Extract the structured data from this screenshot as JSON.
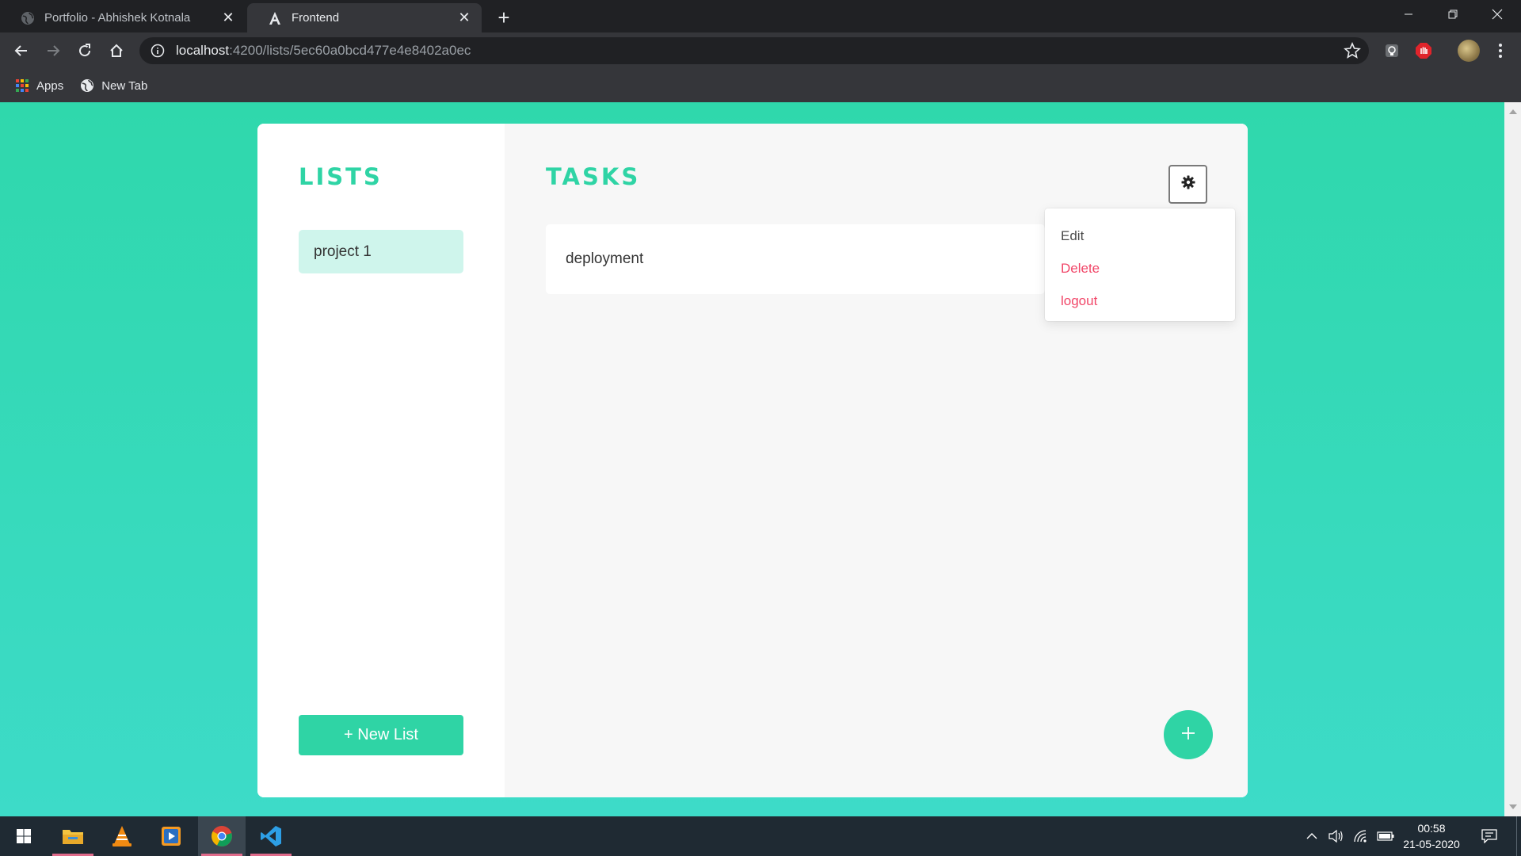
{
  "browser": {
    "tabs": [
      {
        "title": "Portfolio - Abhishek Kotnala",
        "active": false,
        "icon": "globe-icon"
      },
      {
        "title": "Frontend",
        "active": true,
        "icon": "angular-icon"
      }
    ],
    "url_host": "localhost",
    "url_rest": ":4200/lists/5ec60a0bcd477e4e8402a0ec",
    "bookmarks": [
      {
        "label": "Apps",
        "icon": "apps-grid-icon"
      },
      {
        "label": "New Tab",
        "icon": "globe-icon"
      }
    ]
  },
  "app": {
    "lists_heading": "LISTS",
    "tasks_heading": "TASKS",
    "lists": [
      {
        "label": "project 1"
      }
    ],
    "new_list_label": "+ New List",
    "tasks": [
      {
        "label": "deployment"
      }
    ],
    "settings_menu": {
      "items": [
        {
          "label": "Edit",
          "style": "normal"
        },
        {
          "label": "Delete",
          "style": "danger"
        },
        {
          "label": "logout",
          "style": "danger"
        }
      ]
    },
    "add_task_icon": "plus-icon"
  },
  "colors": {
    "accent": "#2fd4a5",
    "background_top": "#2fd8ac",
    "background_bottom": "#3ddbc8",
    "list_item_bg": "#cff5ec",
    "danger": "#f14668"
  },
  "taskbar": {
    "pinned": [
      "windows-start-icon",
      "file-explorer-icon",
      "vlc-icon",
      "media-player-icon",
      "chrome-icon",
      "vscode-icon"
    ],
    "time": "00:58",
    "date": "21-05-2020"
  }
}
